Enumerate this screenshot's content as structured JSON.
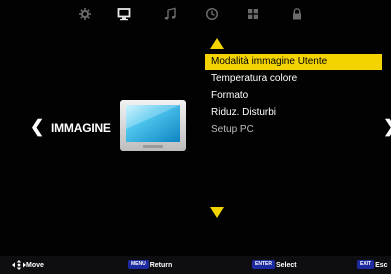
{
  "top_icons": [
    "gear-icon",
    "monitor-icon",
    "music-note-icon",
    "clock-icon",
    "grid-icon",
    "lock-icon"
  ],
  "active_top_icon": "monitor-icon",
  "category": {
    "title": "IMMAGINE"
  },
  "menu": {
    "items": [
      {
        "label": "Modalità immagine Utente",
        "state": "selected"
      },
      {
        "label": "Temperatura colore",
        "state": "normal"
      },
      {
        "label": "Formato",
        "state": "normal"
      },
      {
        "label": "Riduz. Disturbi",
        "state": "normal"
      },
      {
        "label": "Setup PC",
        "state": "disabled"
      }
    ]
  },
  "bottom_bar": {
    "move": "Move",
    "return_key": "MENU",
    "return_label": "Return",
    "select_key": "ENTER",
    "select_label": "Select",
    "exit_key": "EXIT",
    "exit_label": "Esc"
  },
  "colors": {
    "accent": "#f3d400",
    "background": "#020202",
    "key_blue": "#1e2aa0"
  }
}
